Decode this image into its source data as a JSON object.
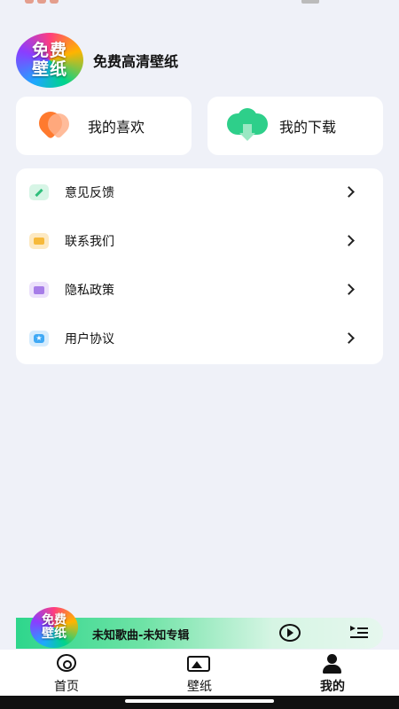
{
  "profile": {
    "logo_line1": "免费",
    "logo_line2": "壁纸",
    "title": "免费高清壁纸"
  },
  "quick_actions": {
    "favorites_label": "我的喜欢",
    "downloads_label": "我的下载"
  },
  "menu": {
    "items": [
      {
        "label": "意见反馈",
        "icon": "pencil-icon",
        "color": "#3ecf8e"
      },
      {
        "label": "联系我们",
        "icon": "envelope-icon",
        "color": "#f6b93b"
      },
      {
        "label": "隐私政策",
        "icon": "message-icon",
        "color": "#a77de8"
      },
      {
        "label": "用户协议",
        "icon": "star-badge-icon",
        "color": "#3fa9f5"
      }
    ]
  },
  "player": {
    "art_line1": "免费",
    "art_line2": "壁纸",
    "track": "未知歌曲-未知专辑"
  },
  "tabs": [
    {
      "label": "首页",
      "icon": "music-disc-icon",
      "active": false
    },
    {
      "label": "壁纸",
      "icon": "image-icon",
      "active": false
    },
    {
      "label": "我的",
      "icon": "person-icon",
      "active": true
    }
  ]
}
